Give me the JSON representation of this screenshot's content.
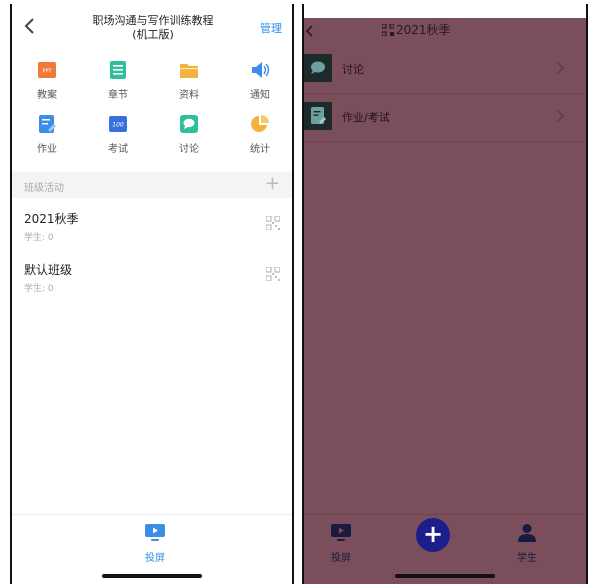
{
  "left": {
    "header": {
      "title_line1": "职场沟通与写作训练教程",
      "title_line2": "(机工版)",
      "manage_label": "管理"
    },
    "grid": [
      {
        "label": "教案",
        "icon": "ppt-icon"
      },
      {
        "label": "章节",
        "icon": "chapter-icon"
      },
      {
        "label": "资料",
        "icon": "folder-icon"
      },
      {
        "label": "通知",
        "icon": "speaker-icon"
      },
      {
        "label": "作业",
        "icon": "homework-icon"
      },
      {
        "label": "考试",
        "icon": "exam-icon"
      },
      {
        "label": "讨论",
        "icon": "discussion-icon"
      },
      {
        "label": "统计",
        "icon": "pie-chart-icon"
      }
    ],
    "ppt_text": "PPT",
    "exam_text": "100",
    "section": {
      "title": "班级活动",
      "add": "+"
    },
    "classes": [
      {
        "name": "2021秋季",
        "students": "学生: 0"
      },
      {
        "name": "默认班级",
        "students": "学生: 0"
      }
    ],
    "bottom": {
      "project_label": "投屏"
    }
  },
  "right": {
    "header": {
      "title": "2021秋季"
    },
    "rows": [
      {
        "label": "讨论",
        "icon": "discussion-icon"
      },
      {
        "label": "作业/考试",
        "icon": "homework-icon"
      }
    ],
    "bottom": {
      "project_label": "投屏",
      "add": "+",
      "student_label": "学生"
    }
  },
  "colors": {
    "accent": "#2f8ee8",
    "overlay": "#7a4e5b",
    "fab": "#1c1e8c"
  }
}
